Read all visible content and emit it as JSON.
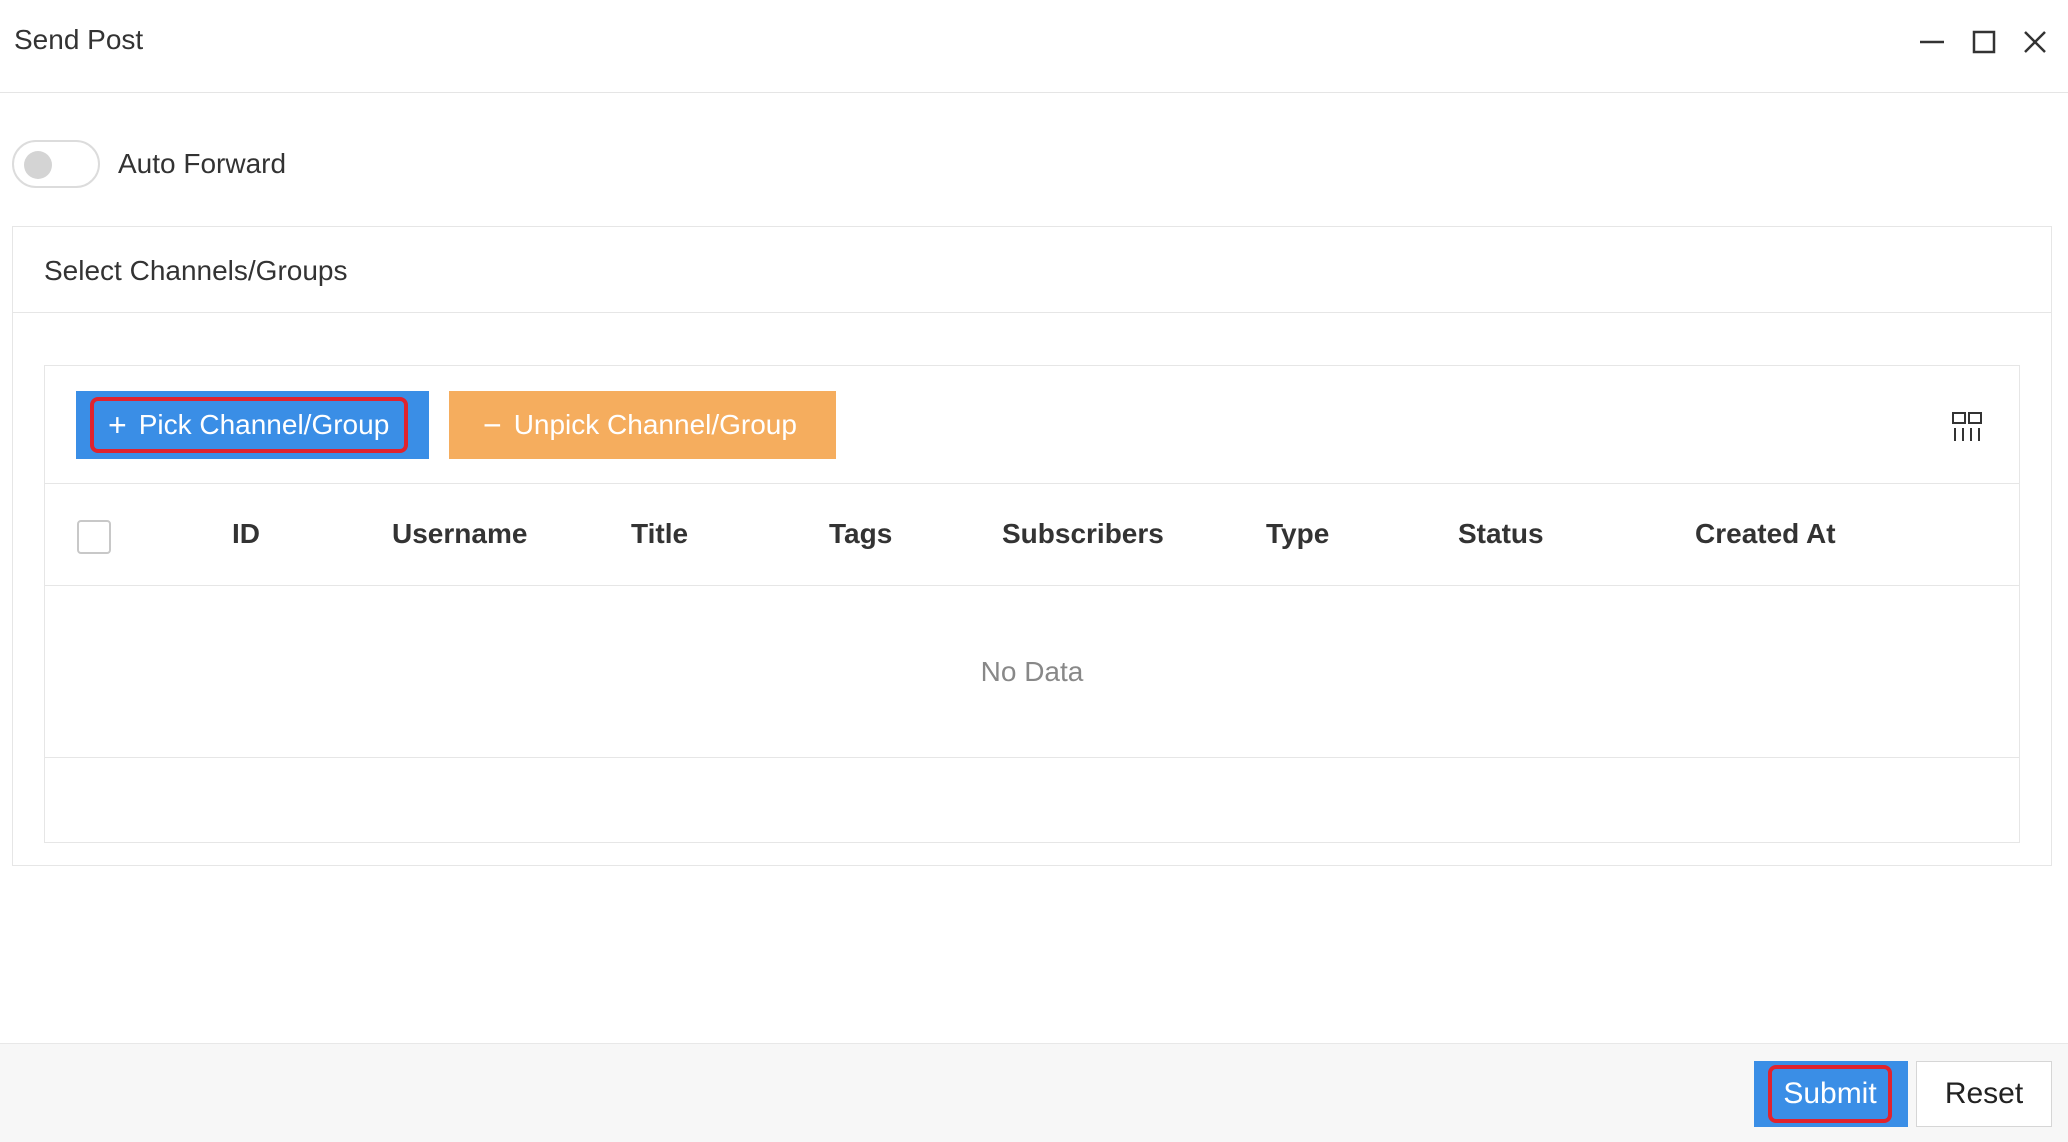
{
  "window": {
    "title": "Send Post",
    "controls": [
      "minimize-icon",
      "maximize-icon",
      "close-icon"
    ]
  },
  "auto_forward": {
    "label": "Auto Forward",
    "enabled": false
  },
  "card": {
    "title": "Select Channels/Groups"
  },
  "toolbar": {
    "pick_glyph": "+",
    "pick_label": "Pick Channel/Group",
    "unpick_glyph": "−",
    "unpick_label": "Unpick Channel/Group",
    "columns_icon": "columns-grid-icon"
  },
  "table": {
    "columns": [
      "ID",
      "Username",
      "Title",
      "Tags",
      "Subscribers",
      "Type",
      "Status",
      "Created At"
    ],
    "rows": [],
    "empty_text": "No Data"
  },
  "footer": {
    "submit_label": "Submit",
    "reset_label": "Reset"
  },
  "colors": {
    "primary": "#3a8ee6",
    "warning": "#f5ad5e",
    "highlight": "#e0232e"
  }
}
